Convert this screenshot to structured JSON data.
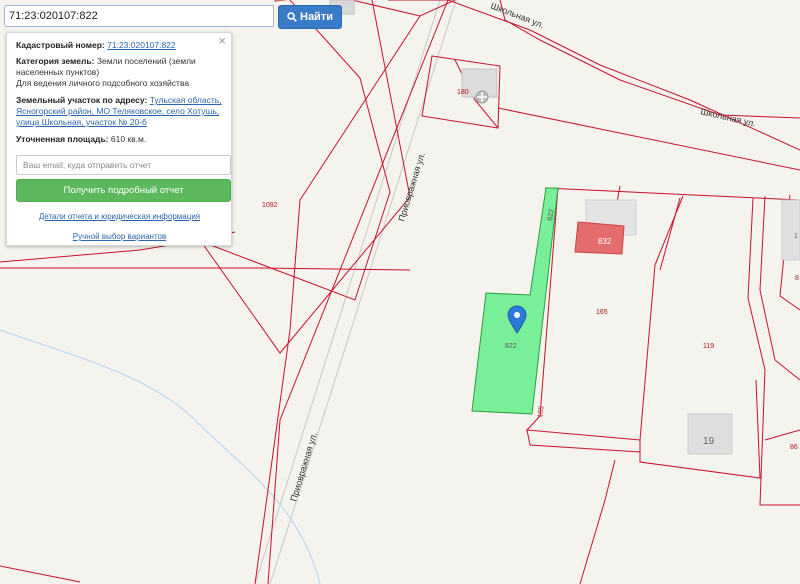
{
  "search": {
    "value": "71:23:020107:822",
    "button_label": "Найти"
  },
  "info_panel": {
    "close_symbol": "×",
    "cadastral_label": "Кадастровый номер:",
    "cadastral_value": "71:23:020107:822",
    "land_category_label": "Категория земель:",
    "land_category_value": "Земли поселений (земли населенных пунктов)",
    "land_use": "Для ведения личного подсобного хозяйства",
    "address_label": "Земельный участок по адресу:",
    "address_value": "Тульская область, Ясногорский район, МО Теляковское, село Хотушь, улица Школьная, участок № 20-б",
    "area_label": "Уточненная площадь:",
    "area_value": "610 кв.м.",
    "email_placeholder": "Ваш email, куда отправить отчет",
    "report_button": "Получить подробный отчет",
    "details_link": "Детали отчета и юридическая информация",
    "manual_link": "Ручной выбор вариантов"
  },
  "map": {
    "street_labels": {
      "shkolnaya_top": "Школьная ул.",
      "shkolnaya_right": "Школьная ул.",
      "privrazhnaya_upper": "Приовражная ул.",
      "privrazhnaya_lower": "Приовражная ул."
    },
    "parcel_labels": {
      "p180": "180",
      "p1092": "1092",
      "p822_edge": "822",
      "p822": "822",
      "p165": "165",
      "p165_edge": "165",
      "p119": "119",
      "p86": "86",
      "p8": "8",
      "p1": "1"
    },
    "building_labels": {
      "b832": "832",
      "b19": "19"
    },
    "colors": {
      "boundary": "#c8102e",
      "selected_fill": "#7aef9a",
      "selected_stroke": "#2e9e3e",
      "marker": "#2a7ad6",
      "building_red": "#e07070",
      "building_gray": "#d9d9d9"
    }
  }
}
